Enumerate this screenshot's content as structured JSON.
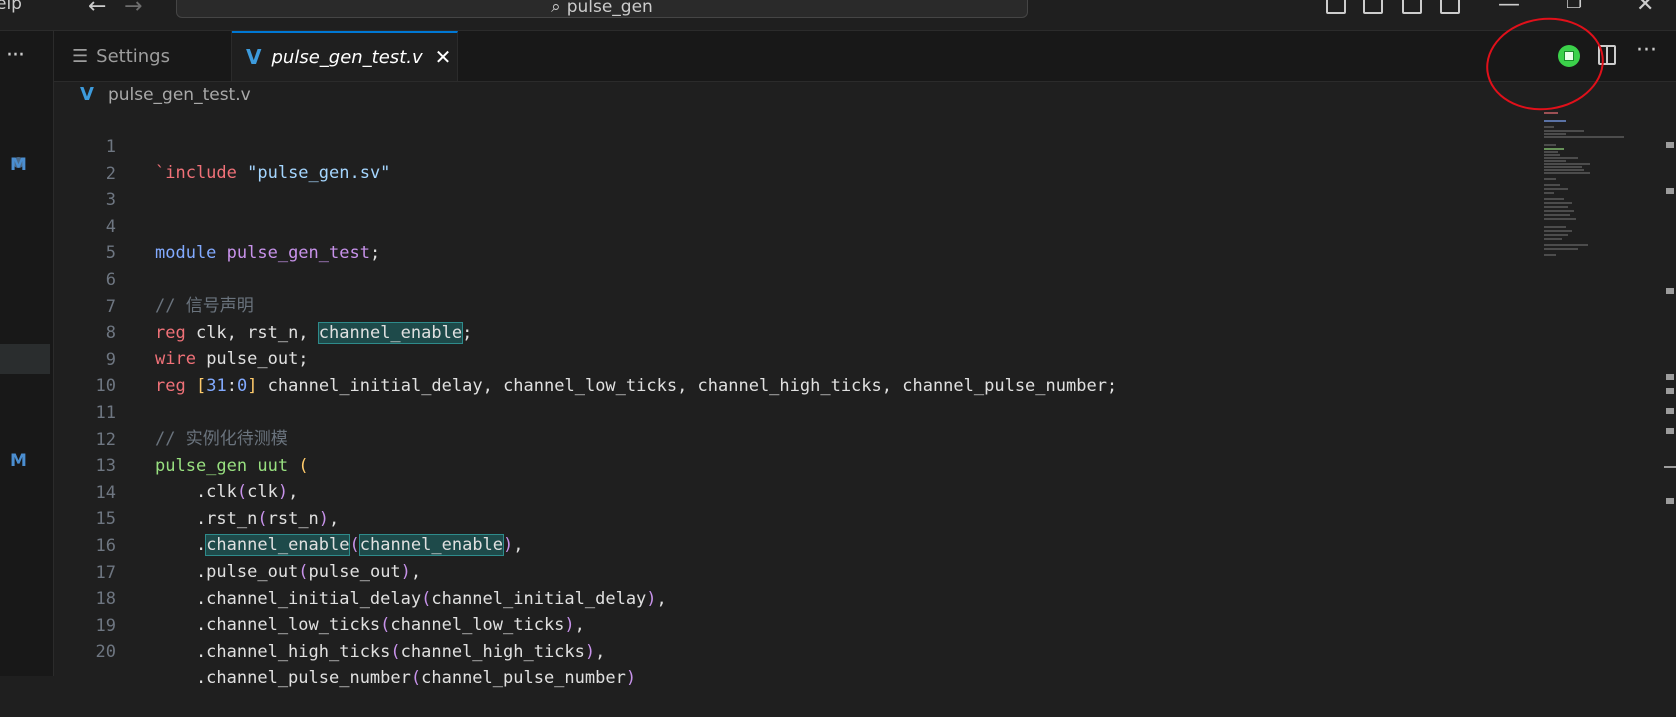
{
  "titlebar": {
    "menu_fragment": "elp",
    "back_icon": "arrow-left-icon",
    "forward_icon": "arrow-right-icon",
    "search_text": "pulse_gen"
  },
  "activity": {
    "more": "···",
    "scm_badge_1": "M",
    "scm_badge_2": "M"
  },
  "tabs": [
    {
      "label": "Settings",
      "icon": "settings-icon"
    },
    {
      "label": "pulse_gen_test.v",
      "icon": "verilog-icon",
      "close": "✕"
    }
  ],
  "breadcrumb": {
    "file": "pulse_gen_test.v"
  },
  "editor": {
    "lines": [
      {
        "n": "1"
      },
      {
        "n": "2"
      },
      {
        "n": "3"
      },
      {
        "n": "4"
      },
      {
        "n": "5"
      },
      {
        "n": "6"
      },
      {
        "n": "7"
      },
      {
        "n": "8"
      },
      {
        "n": "9"
      },
      {
        "n": "10"
      },
      {
        "n": "11"
      },
      {
        "n": "12"
      },
      {
        "n": "13"
      },
      {
        "n": "14"
      },
      {
        "n": "15"
      },
      {
        "n": "16"
      },
      {
        "n": "17"
      },
      {
        "n": "18"
      },
      {
        "n": "19"
      },
      {
        "n": "20"
      }
    ],
    "t": {
      "l1a": "`include",
      "l1b": " \"pulse_gen.sv\"",
      "l4a": "module",
      "l4b": " pulse_gen_test",
      "l4c": ";",
      "l6": "// 信号声明",
      "l7a": "reg",
      "l7b": " clk, rst_n, ",
      "l7c": "channel_enable",
      "l7d": ";",
      "l8a": "wire",
      "l8b": " pulse_out;",
      "l9a": "reg",
      "l9b": " [",
      "l9c": "31",
      "l9d": ":",
      "l9e": "0",
      "l9f": "]",
      "l9g": " channel_initial_delay, channel_low_ticks, channel_high_ticks, channel_pulse_number;",
      "l11": "// 实例化待测模",
      "l12a": "pulse_gen",
      "l12b": " uut ",
      "l12c": "(",
      "l13a": "    .clk",
      "l13b": "(",
      "l13c": "clk",
      "l13d": ")",
      "l13e": ",",
      "l14a": "    .rst_n",
      "l14b": "(",
      "l14c": "rst_n",
      "l14d": ")",
      "l14e": ",",
      "l15a": "    .",
      "l15b": "channel_enable",
      "l15c": "(",
      "l15d": "channel_enable",
      "l15e": ")",
      "l15f": ",",
      "l16a": "    .pulse_out",
      "l16b": "(",
      "l16c": "pulse_out",
      "l16d": ")",
      "l16e": ",",
      "l17a": "    .channel_initial_delay",
      "l17b": "(",
      "l17c": "channel_initial_delay",
      "l17d": ")",
      "l17e": ",",
      "l18a": "    .channel_low_ticks",
      "l18b": "(",
      "l18c": "channel_low_ticks",
      "l18d": ")",
      "l18e": ",",
      "l19a": "    .channel_high_ticks",
      "l19b": "(",
      "l19c": "channel_high_ticks",
      "l19d": ")",
      "l19e": ",",
      "l20a": "    .channel_pulse_number",
      "l20b": "(",
      "l20c": "channel_pulse_number",
      "l20d": ")"
    }
  },
  "colors": {
    "keyword": "#f07178",
    "type": "#82aaff",
    "module_name": "#98e080",
    "accent": "#0078d4",
    "annotation": "#e0101a"
  }
}
